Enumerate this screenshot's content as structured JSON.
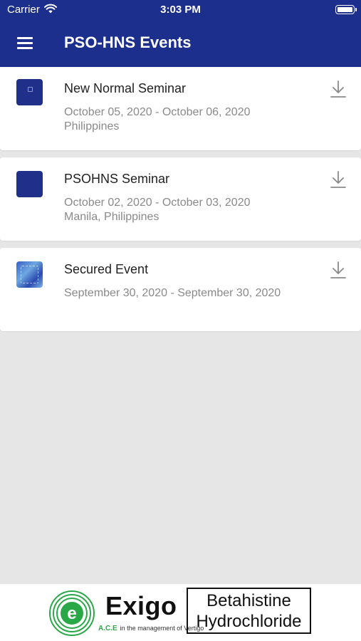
{
  "status_bar": {
    "carrier": "Carrier",
    "time": "3:03 PM"
  },
  "nav": {
    "title": "PSO-HNS Events",
    "menu_icon": "hamburger-menu-icon"
  },
  "events": [
    {
      "name": "New Normal Seminar",
      "dates": "October 05, 2020 - October 06, 2020",
      "location": "Philippines",
      "icon": "download-icon"
    },
    {
      "name": "PSOHNS Seminar",
      "dates": "October 02, 2020 - October 03, 2020",
      "location": "Manila, Philippines",
      "icon": "download-icon"
    },
    {
      "name": "Secured Event",
      "dates": "September 30, 2020 - September 30, 2020",
      "location": "",
      "icon": "download-icon"
    }
  ],
  "footer": {
    "brand": "Exigo",
    "tagline_ace": "A.C.E",
    "tagline_rest": "in the management of Vertigo",
    "drug_line1": "Betahistine",
    "drug_line2": "Hydrochloride"
  },
  "colors": {
    "header_bg": "#1c2f8c",
    "list_bg": "#e6e6e6",
    "card_bg": "#ffffff",
    "secondary_text": "#8a8a8a",
    "brand_green": "#2aa848"
  }
}
